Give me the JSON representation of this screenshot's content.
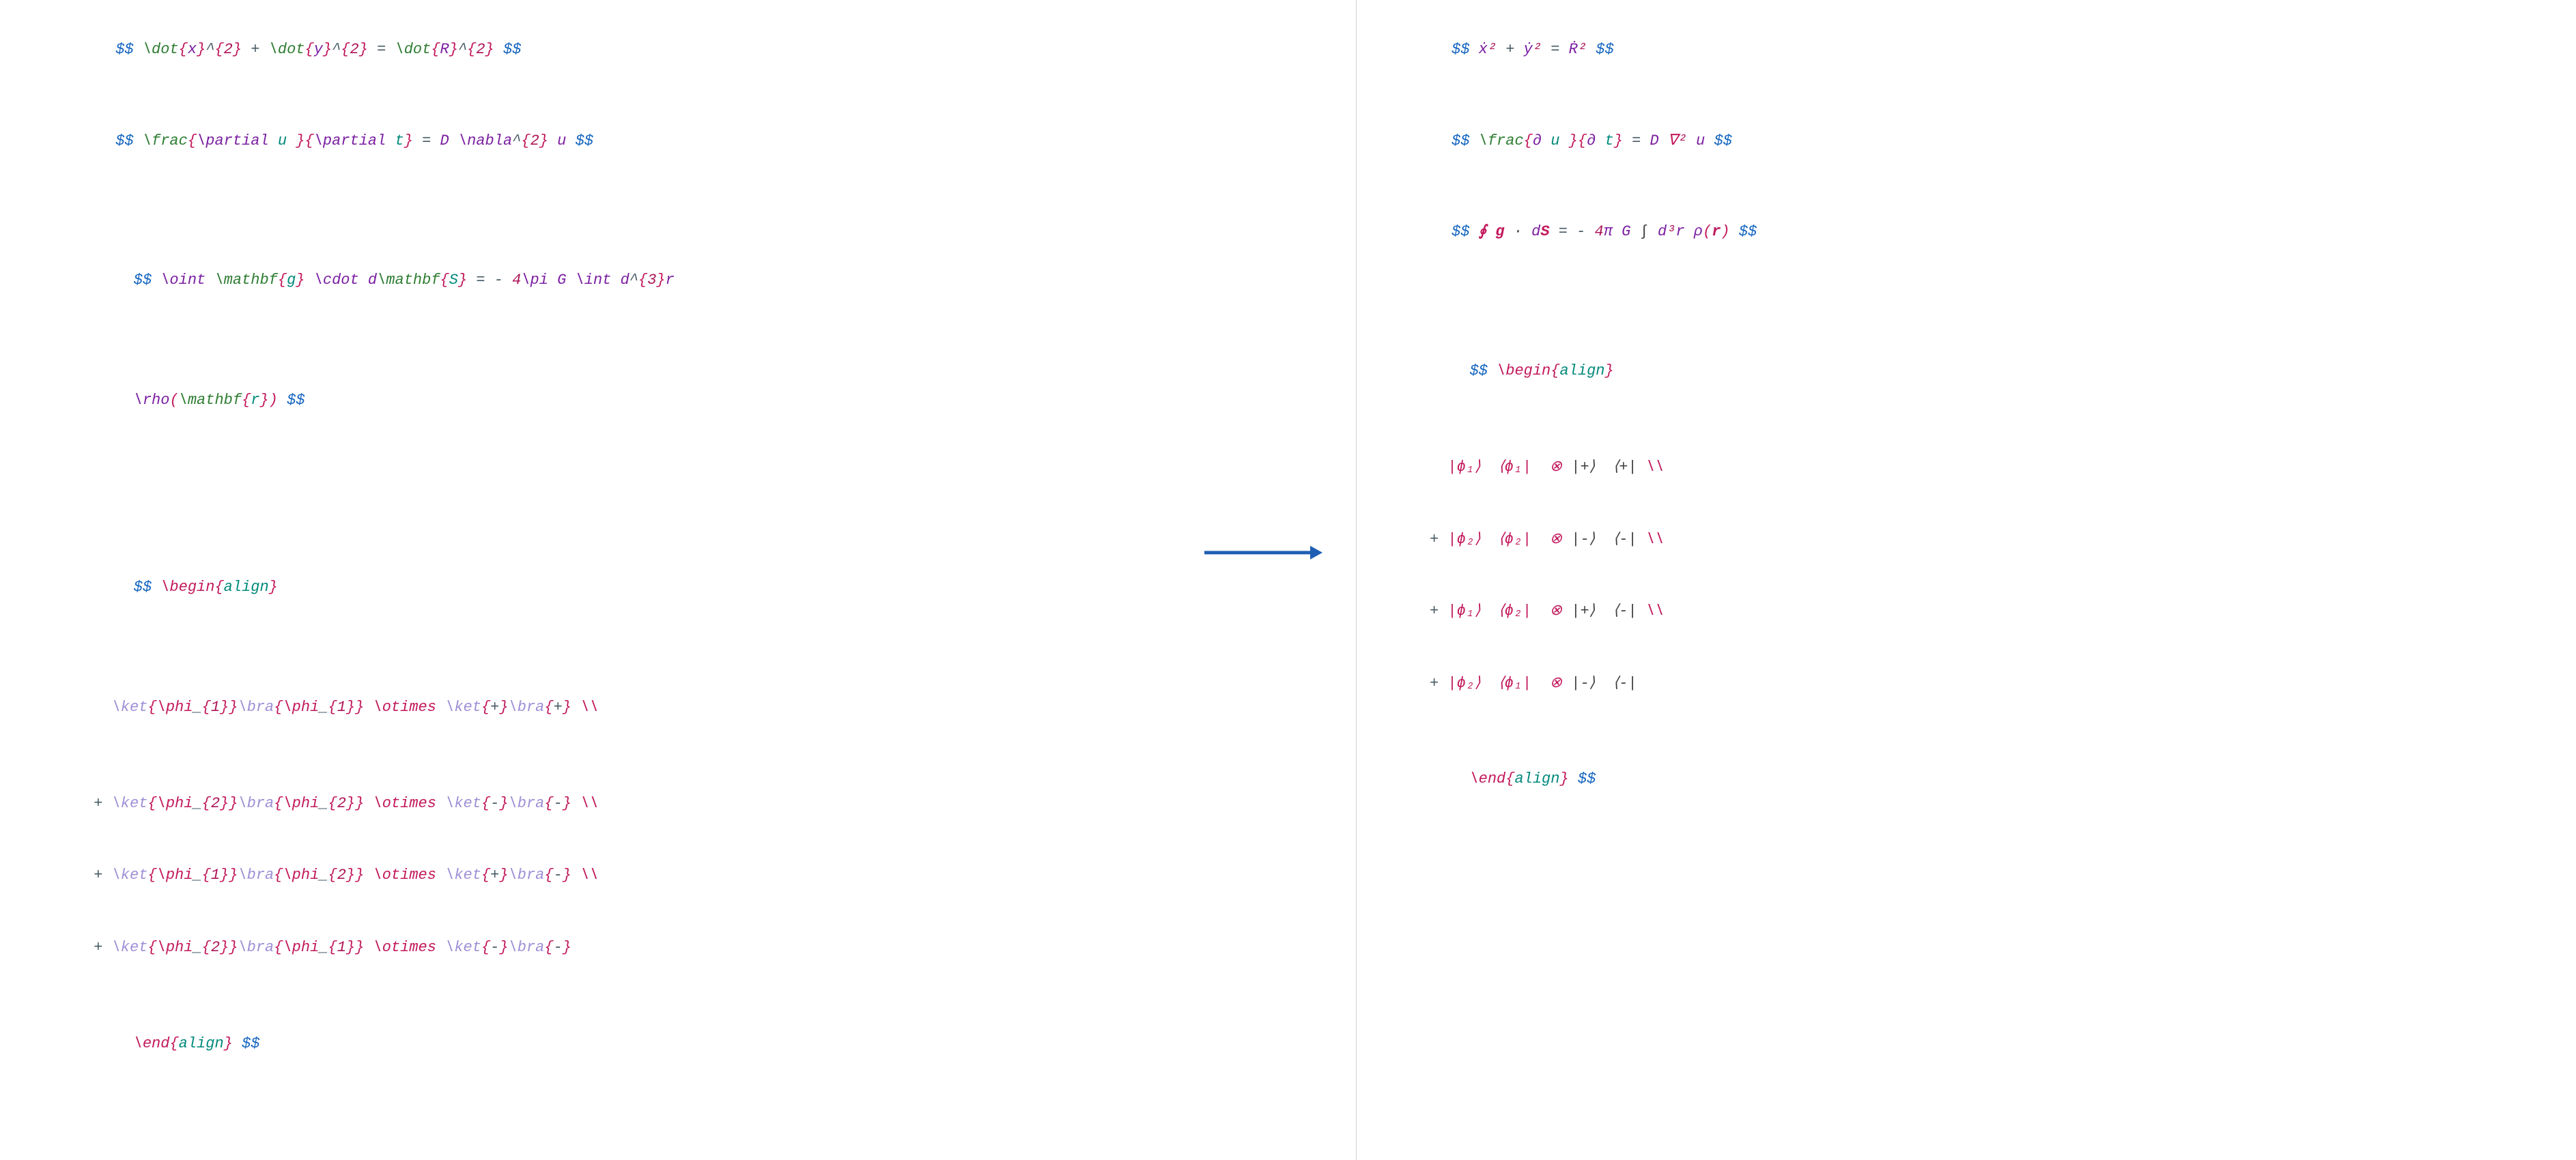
{
  "left": {
    "line1": {
      "dd_open": "$$",
      "dot1": "\\dot",
      "lb1": "{",
      "x": "x",
      "rb1": "}",
      "caret1": "^",
      "lb2": "{",
      "two1": "2",
      "rb2": "}",
      "plus": " + ",
      "dot2": "\\dot",
      "lb3": "{",
      "y": "y",
      "rb3": "}",
      "caret2": "^",
      "lb4": "{",
      "two2": "2",
      "rb4": "}",
      "eq": " = ",
      "dot3": "\\dot",
      "lb5": "{",
      "R": "R",
      "rb5": "}",
      "caret3": "^",
      "lb6": "{",
      "two3": "2",
      "rb6": "}",
      "dd_close": " $$"
    },
    "line2": {
      "dd_open": "$$ ",
      "frac": "\\frac",
      "lb1": "{",
      "partial1": "\\partial",
      "sp1": " u ",
      "rb1": "}",
      "lb2": "{",
      "partial2": "\\partial",
      "sp2": " t",
      "rb2": "}",
      "eq": " = ",
      "D": "D ",
      "nabla": "\\nabla",
      "caret": "^",
      "lb3": "{",
      "two": "2",
      "rb3": "}",
      "u": " u ",
      "dd_close": "$$"
    },
    "line3": {
      "dd_open": "$$ ",
      "oint": "\\oint",
      "sp0": " ",
      "mathbf1": "\\mathbf",
      "lb1": "{",
      "g": "g",
      "rb1": "}",
      "sp1": " ",
      "cdot": "\\cdot",
      "sp2": " d",
      "mathbf2": "\\mathbf",
      "lb2": "{",
      "S": "S",
      "rb2": "}",
      "eq": " = - ",
      "four": "4",
      "pi": "\\pi",
      "G": " G ",
      "int": "\\int",
      "d3r": " d",
      "caret": "^",
      "lb3": "{",
      "three": "3",
      "rb3": "}",
      "r": "r"
    },
    "line3b": {
      "rho": "\\rho",
      "lp": "(",
      "mathbf": "\\mathbf",
      "lb": "{",
      "rr": "r",
      "rb": "}",
      "rp": ")",
      "dd_close": " $$"
    },
    "block4": {
      "dd_open": "$$ ",
      "begin": "\\begin",
      "lb": "{",
      "align": "align",
      "rb": "}",
      "row1": {
        "pre": "   ",
        "ket": "\\ket",
        "lb1": "{",
        "phi1": "\\phi",
        "us1": "_",
        "lb1b": "{",
        "one1": "1",
        "rb1b": "}",
        "rb1": "}",
        "bra": "\\bra",
        "lb2": "{",
        "phi2": "\\phi",
        "us2": "_",
        "lb2b": "{",
        "one2": "1",
        "rb2b": "}",
        "rb2": "}",
        "sp": " ",
        "otimes": "\\otimes",
        "sp2": " ",
        "ket2": "\\ket",
        "lb3": "{",
        "plus": "+",
        "rb3": "}",
        "bra2": "\\bra",
        "lb4": "{",
        "plus2": "+",
        "rb4": "}",
        "end": " \\\\"
      },
      "row2": {
        "pre": " + ",
        "ket": "\\ket",
        "lb1": "{",
        "phi1": "\\phi",
        "us1": "_",
        "lb1b": "{",
        "two1": "2",
        "rb1b": "}",
        "rb1": "}",
        "bra": "\\bra",
        "lb2": "{",
        "phi2": "\\phi",
        "us2": "_",
        "lb2b": "{",
        "two2": "2",
        "rb2b": "}",
        "rb2": "}",
        "sp": " ",
        "otimes": "\\otimes",
        "sp2": " ",
        "ket2": "\\ket",
        "lb3": "{",
        "minus": "-",
        "rb3": "}",
        "bra2": "\\bra",
        "lb4": "{",
        "minus2": "-",
        "rb4": "}",
        "end": " \\\\"
      },
      "row3": {
        "pre": " + ",
        "ket": "\\ket",
        "lb1": "{",
        "phi1": "\\phi",
        "us1": "_",
        "lb1b": "{",
        "one1": "1",
        "rb1b": "}",
        "rb1": "}",
        "bra": "\\bra",
        "lb2": "{",
        "phi2": "\\phi",
        "us2": "_",
        "lb2b": "{",
        "two2": "2",
        "rb2b": "}",
        "rb2": "}",
        "sp": " ",
        "otimes": "\\otimes",
        "sp2": " ",
        "ket2": "\\ket",
        "lb3": "{",
        "plus": "+",
        "rb3": "}",
        "bra2": "\\bra",
        "lb4": "{",
        "minus": "-",
        "rb4": "}",
        "end": " \\\\"
      },
      "row4": {
        "pre": " + ",
        "ket": "\\ket",
        "lb1": "{",
        "phi1": "\\phi",
        "us1": "_",
        "lb1b": "{",
        "two1": "2",
        "rb1b": "}",
        "rb1": "}",
        "bra": "\\bra",
        "lb2": "{",
        "phi2": "\\phi",
        "us2": "_",
        "lb2b": "{",
        "one2": "1",
        "rb2b": "}",
        "rb2": "}",
        "sp": " ",
        "otimes": "\\otimes",
        "sp2": " ",
        "ket2": "\\ket",
        "lb3": "{",
        "minus": "-",
        "rb3": "}",
        "bra2": "\\bra",
        "lb4": "{",
        "minus2": "-",
        "rb4": "}",
        "end": ""
      },
      "end": "\\end",
      "lb2": "{",
      "align2": "align",
      "rb2": "}",
      "dd_close": " $$"
    }
  },
  "right": {
    "line1": {
      "dd_open": "$$ ",
      "xdot": "ẋ",
      "sup1": "²",
      "plus": " + ",
      "ydot": "ẏ",
      "sup2": "²",
      "eq": " = ",
      "Rdot": "Ṙ",
      "sup3": "²",
      "dd_close": " $$"
    },
    "line2": {
      "dd_open": "$$ ",
      "frac": "\\frac",
      "lb1": "{",
      "partial1": "∂",
      "sp1": " u ",
      "rb1": "}",
      "lb2": "{",
      "partial2": "∂",
      "sp2": " t",
      "rb2": "}",
      "eq": " = ",
      "D": "D ",
      "nabla": "∇",
      "sup": "²",
      "u": " u ",
      "dd_close": "$$"
    },
    "line3": {
      "dd_open": "$$ ",
      "oint": "∮",
      "sp0": " ",
      "g": "g",
      "sp1": " ",
      "cdot": "·",
      "sp2": " d",
      "S": "S",
      "eq": " = - ",
      "four": "4",
      "pi": "π",
      "G": " G ",
      "int": "∫",
      "d": " d",
      "three": "³",
      "r": "r ",
      "rho": "ρ",
      "lp": "(",
      "rr": "r",
      "rp": ")",
      "dd_close": " $$"
    },
    "block4": {
      "dd_open": "$$ ",
      "begin": "\\begin",
      "lb": "{",
      "align": "align",
      "rb": "}",
      "row1": {
        "pre": "   ",
        "ket1": "|ϕ₁⟩",
        "sp1": "  ",
        "bra1": "⟨ϕ₁|",
        "sp2": "  ",
        "otimes": "⊗",
        "sp3": " ",
        "ket2": "|+⟩",
        "sp4": "  ",
        "bra2": "⟨+|",
        "end": " \\\\"
      },
      "row2": {
        "pre": " + ",
        "ket1": "|ϕ₂⟩",
        "sp1": "  ",
        "bra1": "⟨ϕ₂|",
        "sp2": "  ",
        "otimes": "⊗",
        "sp3": " ",
        "ket2": "|-⟩",
        "sp4": "  ",
        "bra2": "⟨-|",
        "end": " \\\\"
      },
      "row3": {
        "pre": " + ",
        "ket1": "|ϕ₁⟩",
        "sp1": "  ",
        "bra1": "⟨ϕ₂|",
        "sp2": "  ",
        "otimes": "⊗",
        "sp3": " ",
        "ket2": "|+⟩",
        "sp4": "  ",
        "bra2": "⟨-|",
        "end": " \\\\"
      },
      "row4": {
        "pre": " + ",
        "ket1": "|ϕ₂⟩",
        "sp1": "  ",
        "bra1": "⟨ϕ₁|",
        "sp2": "  ",
        "otimes": "⊗",
        "sp3": " ",
        "ket2": "|-⟩",
        "sp4": "  ",
        "bra2": "⟨-|",
        "end": ""
      },
      "end": "\\end",
      "lb2": "{",
      "align2": "align",
      "rb2": "}",
      "dd_close": " $$"
    }
  }
}
